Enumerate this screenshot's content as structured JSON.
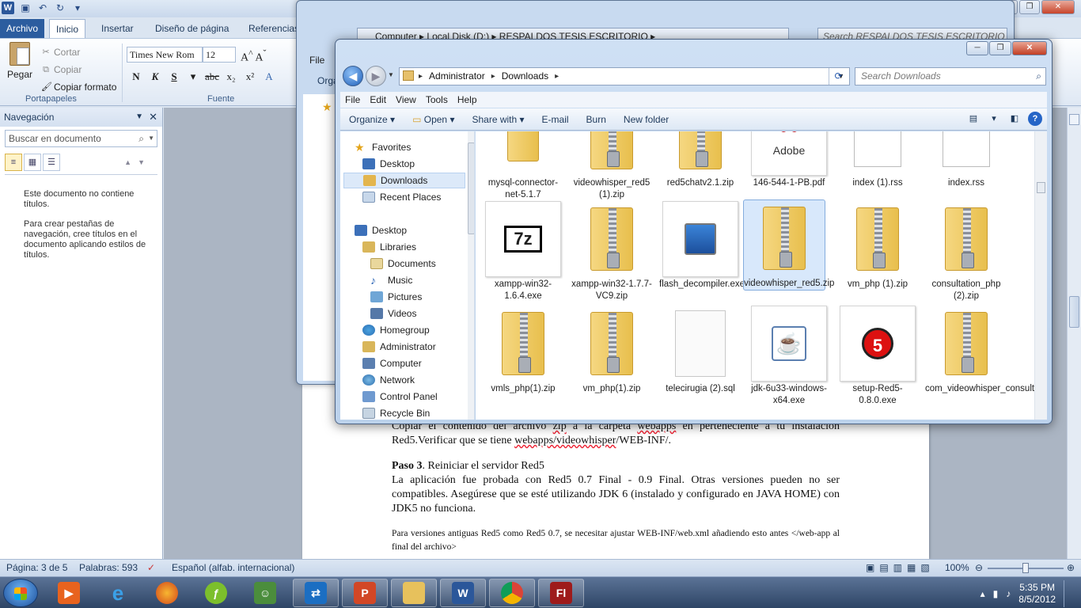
{
  "word": {
    "tabs": [
      "Archivo",
      "Inicio",
      "Insertar",
      "Diseño de página",
      "Referencias"
    ],
    "active_tab": "Inicio",
    "clipboard": {
      "paste": "Pegar",
      "cut": "Cortar",
      "copy": "Copiar",
      "format_painter": "Copiar formato",
      "group": "Portapapeles"
    },
    "font": {
      "family": "Times New Rom",
      "size": "12",
      "group": "Fuente"
    },
    "nav_pane": {
      "title": "Navegación",
      "search_placeholder": "Buscar en documento",
      "msg1": "Este documento no contiene títulos.",
      "msg2": "Para crear pestañas de navegación, cree títulos en el documento aplicando estilos de títulos."
    },
    "doc": {
      "p1_spell1": "zip",
      "p1_a": "Copiar el contenido del archivo ",
      "p1_b": " a la carpeta ",
      "p1_spell2": "webapps",
      "p1_c": " en perteneciente a tu instalación Red5.Verificar que se tiene ",
      "p1_spell3": "webapps/videowhisper",
      "p1_d": "/WEB-INF/.",
      "paso3_bold": "Paso 3",
      "paso3_rest": ". Reiniciar el servidor Red5",
      "p3": "La aplicación fue probada con Red5 0.7 Final - 0.9 Final. Otras versiones pueden no ser compatibles. Asegúrese que se esté utilizando JDK 6 (instalado y configurado en JAVA HOME) con JDK5 no funciona.",
      "p4": "Para versiones antiguas Red5 como Red5 0.7, se necesitar ajustar WEB-INF/web.xml añadiendo esto antes </web-app al final del archivo>"
    },
    "status": {
      "page": "Página: 3 de 5",
      "words": "Palabras: 593",
      "language": "Español (alfab. internacional)",
      "zoom": "100%"
    }
  },
  "explorer_back": {
    "menu_file": "File",
    "toolbar_org": "Orga",
    "address": [
      "Computer",
      "Local Disk (D:)",
      "RESPALDOS TESIS ESCRITORIO"
    ],
    "search_placeholder": "Search RESPALDOS TESIS ESCRITORIO"
  },
  "explorer": {
    "address": [
      "Administrator",
      "Downloads"
    ],
    "search_placeholder": "Search Downloads",
    "menu": [
      "File",
      "Edit",
      "View",
      "Tools",
      "Help"
    ],
    "toolbar": [
      "Organize ▾",
      "Open ▾",
      "Share with ▾",
      "E-mail",
      "Burn",
      "New folder"
    ],
    "tree": {
      "favorites": "Favorites",
      "desktop_fav": "Desktop",
      "downloads": "Downloads",
      "recent": "Recent Places",
      "desktop": "Desktop",
      "libraries": "Libraries",
      "documents": "Documents",
      "music": "Music",
      "pictures": "Pictures",
      "videos": "Videos",
      "homegroup": "Homegroup",
      "administrator": "Administrator",
      "computer": "Computer",
      "network": "Network",
      "control_panel": "Control Panel",
      "recycle_bin": "Recycle Bin"
    },
    "files": [
      {
        "name": "mysql-connector-net-5.1.7",
        "icon": "folder-icon"
      },
      {
        "name": "videowhisper_red5 (1).zip",
        "icon": "zip-icon"
      },
      {
        "name": "red5chatv2.1.zip",
        "icon": "zip-icon"
      },
      {
        "name": "146-544-1-PB.pdf",
        "icon": "pdf-icon"
      },
      {
        "name": "index (1).rss",
        "icon": "rss-icon"
      },
      {
        "name": "index.rss",
        "icon": "rss-icon"
      },
      {
        "name": "xampp-win32-1.6.4.exe",
        "icon": "7z-icon"
      },
      {
        "name": "xampp-win32-1.7.7-VC9.zip",
        "icon": "zip-icon"
      },
      {
        "name": "flash_decompiler.exe",
        "icon": "installer-icon"
      },
      {
        "name": "videowhisper_red5.zip",
        "icon": "zip-icon",
        "selected": true
      },
      {
        "name": "vm_php (1).zip",
        "icon": "zip-icon"
      },
      {
        "name": "consultation_php (2).zip",
        "icon": "zip-icon"
      },
      {
        "name": "vmls_php(1).zip",
        "icon": "zip-icon"
      },
      {
        "name": "vm_php(1).zip",
        "icon": "zip-icon"
      },
      {
        "name": "telecirugia (2).sql",
        "icon": "file-icon"
      },
      {
        "name": "jdk-6u33-windows-x64.exe",
        "icon": "java-icon"
      },
      {
        "name": "setup-Red5-0.8.0.exe",
        "icon": "red5-icon"
      },
      {
        "name": "com_videowhisper_consultation.zip",
        "icon": "zip-icon"
      }
    ],
    "pdf_label": "Adobe",
    "seven_zip_label": "7z",
    "red5_label": "5"
  },
  "taskbar": {
    "time": "5:35 PM",
    "date": "8/5/2012",
    "flash_label": "Fl",
    "word_label": "W",
    "ppt_label": "P"
  }
}
